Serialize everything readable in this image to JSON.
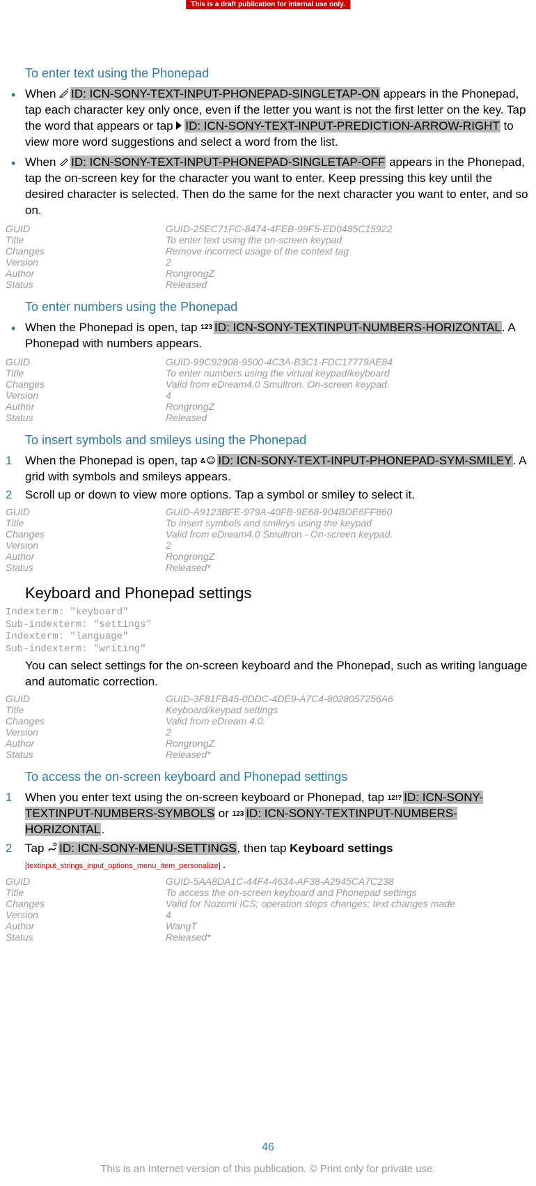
{
  "banner": "This is a draft publication for internal use only.",
  "sections": [
    {
      "heading": "To enter text using the Phonepad",
      "bullets": [
        {
          "pre": "When ",
          "icon_name": "pencil-multitap-on-icon",
          "id_text": "ID: ICN-SONY-TEXT-INPUT-PHONEPAD-SINGLETAP-ON",
          "mid1": " appears in the Phonepad, tap each character key only once, even if the letter you want is not the first letter on the key. Tap the word that appears or tap ",
          "icon2_name": "arrow-right-icon",
          "id2_text": "ID: ICN-SONY-TEXT-INPUT-PREDICTION-ARROW-RIGHT",
          "post": " to view more word suggestions and select a word from the list."
        },
        {
          "pre": "When ",
          "icon_name": "pencil-multitap-off-icon",
          "id_text": "ID: ICN-SONY-TEXT-INPUT-PHONEPAD-SINGLETAP-OFF",
          "post": " appears in the Phonepad, tap the on-screen key for the character you want to enter. Keep pressing this key until the desired character is selected. Then do the same for the next character you want to enter, and so on."
        }
      ],
      "meta": {
        "GUID": "GUID-25EC71FC-8474-4FEB-99F5-ED0485C15922",
        "Title": "To enter text using the on-screen keypad",
        "Changes": "Remove incorrect usage of the context tag",
        "Version": "2",
        "Author": "RongrongZ",
        "Status": "Released"
      }
    },
    {
      "heading": "To enter numbers using the Phonepad",
      "bullets": [
        {
          "pre": "When the Phonepad is open, tap ",
          "icon_text": "123",
          "icon_name": "numbers-123-icon",
          "id_text": "ID: ICN-SONY-TEXTINPUT-NUMBERS-HORIZONTAL",
          "post": ". A Phonepad with numbers appears."
        }
      ],
      "meta": {
        "GUID": "GUID-99C92908-9500-4C3A-B3C1-FDC17779AE84",
        "Title": "To enter numbers using the virtual keypad/keyboard",
        "Changes": "Valid from eDream4.0 Smultron. On-screen keypad.",
        "Version": "4",
        "Author": "RongrongZ",
        "Status": "Released"
      }
    },
    {
      "heading": "To insert symbols and smileys using the Phonepad",
      "steps": [
        {
          "pre": "When the Phonepad is open, tap ",
          "icon_name": "symbols-smiley-icon",
          "id_text": "ID: ICN-SONY-TEXT-INPUT-PHONEPAD-SYM-SMILEY",
          "post": ". A grid with symbols and smileys appears."
        },
        {
          "plain": "Scroll up or down to view more options. Tap a symbol or smiley to select it."
        }
      ],
      "meta": {
        "GUID": "GUID-A9123BFE-979A-40FB-9E68-904BDE6FF860",
        "Title": "To insert symbols and smileys using the keypad",
        "Changes": "Valid from eDream4.0 Smultron - On-screen keypad.",
        "Version": "2",
        "Author": "RongrongZ",
        "Status": "Released*"
      }
    }
  ],
  "bigheading": "Keyboard and Phonepad settings",
  "indexterms": [
    "Indexterm: \"keyboard\"",
    "Sub-indexterm: \"settings\"",
    "Indexterm: \"language\"",
    "Sub-indexterm: \"writing\""
  ],
  "big_body": "You can select settings for the on-screen keyboard and the Phonepad, such as writing language and automatic correction.",
  "big_meta": {
    "GUID": "GUID-3F81FB45-0DDC-4DE9-A7C4-8028057256A6",
    "Title": "Keyboard/keypad settings",
    "Changes": "Valid from eDream 4.0.",
    "Version": "2",
    "Author": "RongrongZ",
    "Status": "Released*"
  },
  "access": {
    "heading": "To access the on-screen keyboard and Phonepad settings",
    "steps": [
      {
        "pre": "When you enter text using the on-screen keyboard or Phonepad, tap ",
        "icon_text": "12!?",
        "icon_name": "numbers-symbols-12-icon",
        "id_text": "ID: ICN-SONY-TEXTINPUT-NUMBERS-SYMBOLS",
        "mid": " or ",
        "icon2_text": "123",
        "icon2_name": "numbers-123-icon",
        "id2_text": "ID: ICN-SONY-TEXTINPUT-NUMBERS-HORIZONTAL",
        "post": "."
      },
      {
        "pre": "Tap ",
        "icon_name": "menu-settings-icon",
        "id_text": "ID: ICN-SONY-MENU-SETTINGS",
        "mid": ", then tap ",
        "bold": "Keyboard settings",
        "string_ref": " [textinput_strings_input_options_menu_item_personalize] ",
        "post": "."
      }
    ],
    "meta": {
      "GUID": "GUID-5AA8DA1C-44F4-4634-AF38-A2945CA7C238",
      "Title": "To access the on-screen keyboard and Phonepad settings",
      "Changes": "Valid for Nozomi ICS; operation steps changes; text changes made",
      "Version": "4",
      "Author": "WangT",
      "Status": "Released*"
    }
  },
  "page_number": "46",
  "footer": "This is an Internet version of this publication. © Print only for private use.",
  "meta_labels": {
    "GUID": "GUID",
    "Title": "Title",
    "Changes": "Changes",
    "Version": "Version",
    "Author": "Author",
    "Status": "Status"
  }
}
